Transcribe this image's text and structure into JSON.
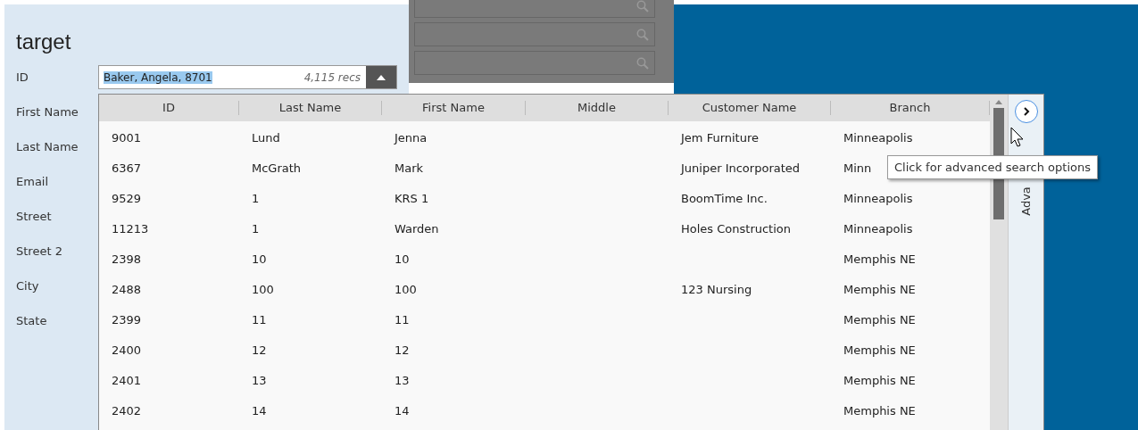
{
  "form": {
    "title": "target",
    "fields": [
      "ID",
      "First Name",
      "Last Name",
      "Email",
      "Street",
      "Street 2",
      "City",
      "State"
    ]
  },
  "id_lookup": {
    "value": "Baker, Angela, 8701",
    "value_selected": true,
    "count": "4,115 recs",
    "expanded": true
  },
  "results": {
    "columns": [
      "ID",
      "Last Name",
      "First Name",
      "Middle",
      "Customer Name",
      "Branch"
    ],
    "rows": [
      [
        "9001",
        "Lund",
        "Jenna",
        "",
        "Jem Furniture",
        "Minneapolis"
      ],
      [
        "6367",
        "McGrath",
        "Mark",
        "",
        "Juniper Incorporated",
        "Minn"
      ],
      [
        "9529",
        "1",
        "KRS 1",
        "",
        "BoomTime Inc.",
        "Minneapolis"
      ],
      [
        "11213",
        "1",
        "Warden",
        "",
        "Holes Construction",
        "Minneapolis"
      ],
      [
        "2398",
        "10",
        "10",
        "",
        "",
        "Memphis NE"
      ],
      [
        "2488",
        "100",
        "100",
        "",
        "123 Nursing",
        "Memphis NE"
      ],
      [
        "2399",
        "11",
        "11",
        "",
        "",
        "Memphis NE"
      ],
      [
        "2400",
        "12",
        "12",
        "",
        "",
        "Memphis NE"
      ],
      [
        "2401",
        "13",
        "13",
        "",
        "",
        "Memphis NE"
      ],
      [
        "2402",
        "14",
        "14",
        "",
        "",
        "Memphis NE"
      ]
    ]
  },
  "advanced_panel": {
    "label": "Adva",
    "tooltip": "Click for advanced search options"
  }
}
